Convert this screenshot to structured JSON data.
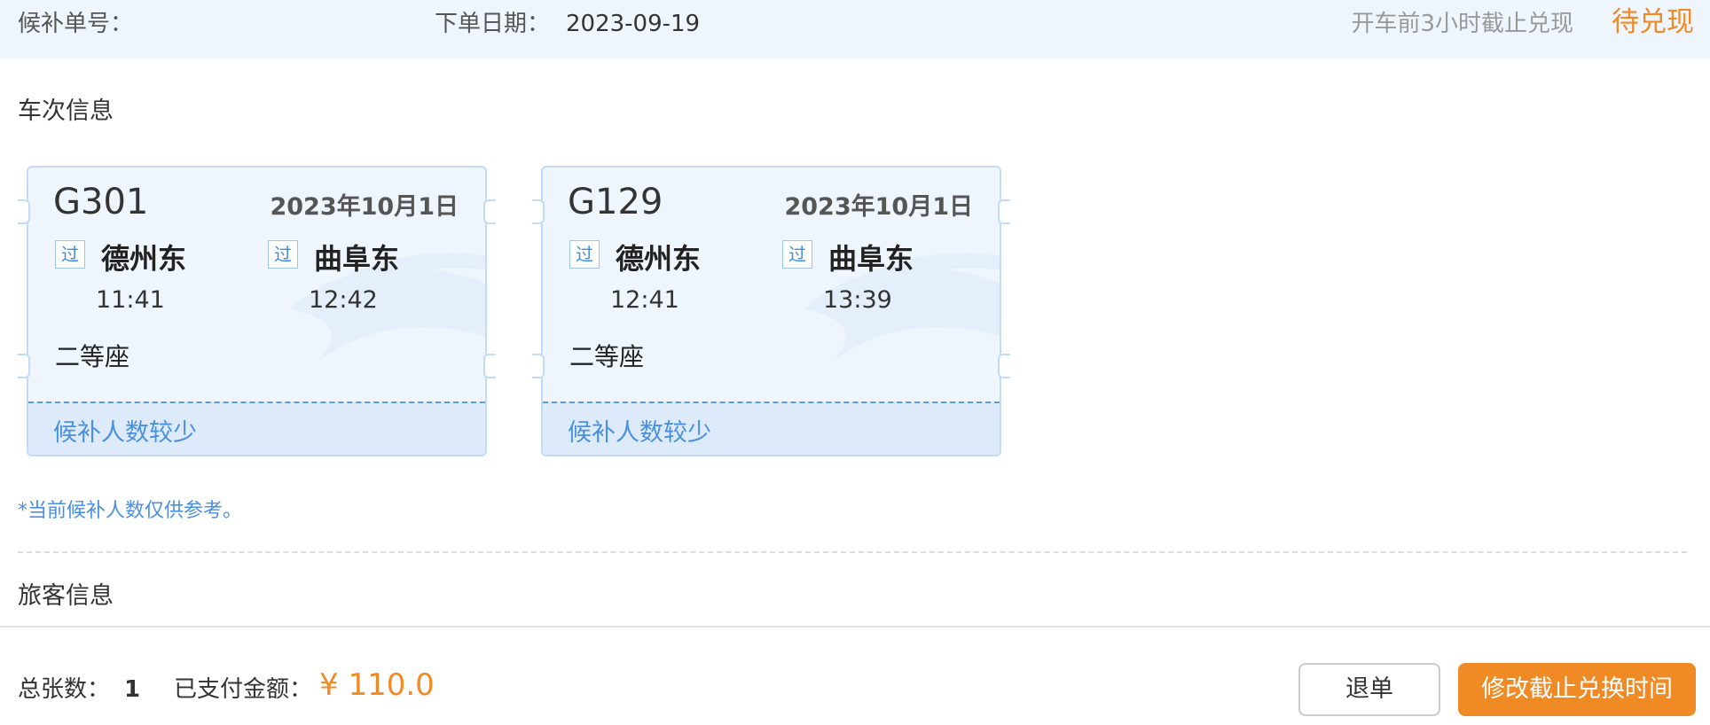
{
  "header": {
    "order_no_label": "候补单号：",
    "order_date_label": "下单日期：",
    "order_date_value": "2023-09-19",
    "deadline_text": "开车前3小时截止兑现",
    "status_text": "待兑现"
  },
  "train_section": {
    "title": "车次信息",
    "tickets": [
      {
        "train_no": "G301",
        "date": "2023年10月1日",
        "from_tag": "过",
        "from_station": "德州东",
        "from_time": "11:41",
        "to_tag": "过",
        "to_station": "曲阜东",
        "to_time": "12:42",
        "seat": "二等座",
        "queue_status": "候补人数较少"
      },
      {
        "train_no": "G129",
        "date": "2023年10月1日",
        "from_tag": "过",
        "from_station": "德州东",
        "from_time": "12:41",
        "to_tag": "过",
        "to_station": "曲阜东",
        "to_time": "13:39",
        "seat": "二等座",
        "queue_status": "候补人数较少"
      }
    ],
    "note": "*当前候补人数仅供参考。"
  },
  "passenger_section": {
    "title": "旅客信息"
  },
  "footer": {
    "total_label": "总张数：",
    "total_value": "1",
    "paid_label": "已支付金额：",
    "paid_value": "¥ 110.0",
    "refund_button": "退单",
    "modify_button": "修改截止兑换时间"
  },
  "colors": {
    "accent_orange": "#f08a24",
    "accent_blue": "#4a90e2",
    "ticket_bg": "#eef5fd"
  }
}
